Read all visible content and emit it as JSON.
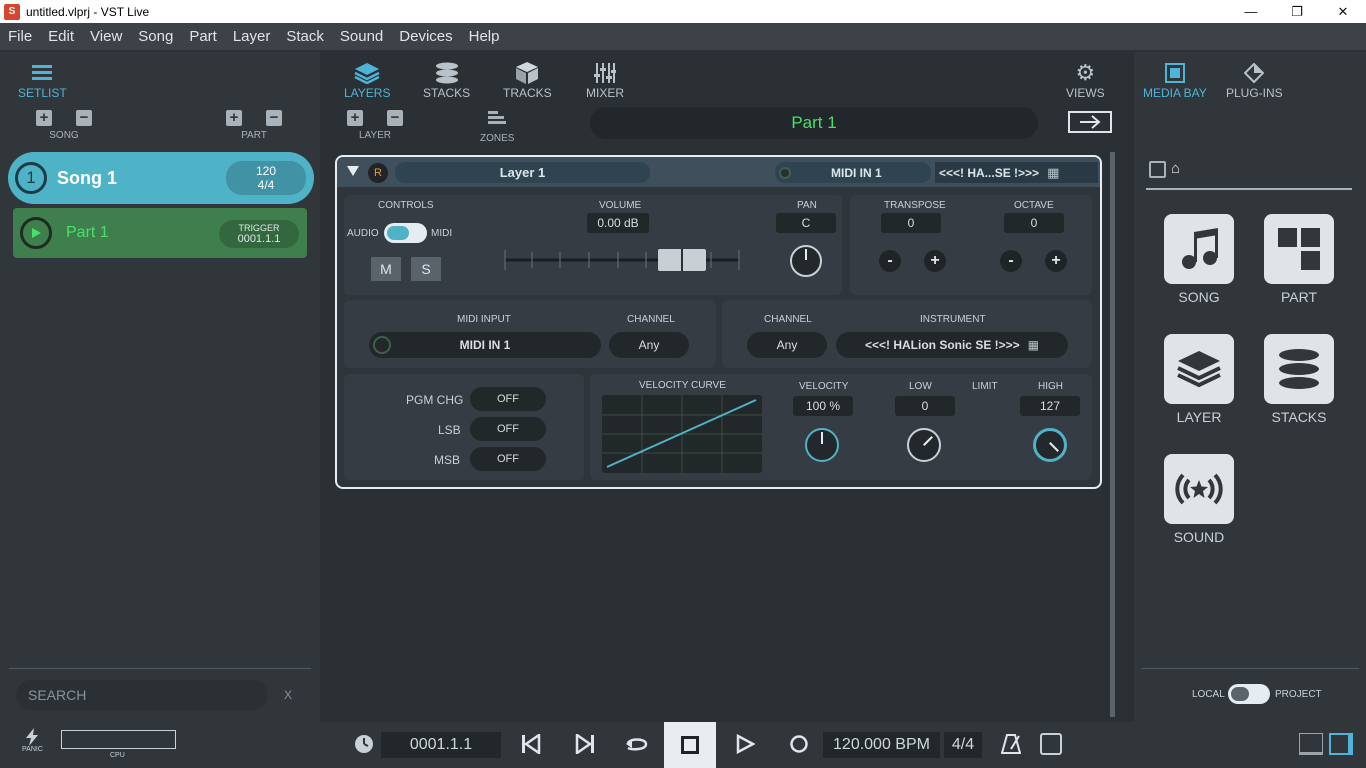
{
  "window": {
    "title": "untitled.vlprj - VST Live",
    "app_icon_text": "S"
  },
  "menu": [
    "File",
    "Edit",
    "View",
    "Song",
    "Part",
    "Layer",
    "Stack",
    "Sound",
    "Devices",
    "Help"
  ],
  "left": {
    "setlist_label": "SETLIST",
    "song_label": "SONG",
    "part_label": "PART",
    "song": {
      "number": "1",
      "name": "Song 1",
      "tempo": "120",
      "signature": "4/4"
    },
    "part": {
      "name": "Part 1",
      "trigger_label": "TRIGGER",
      "trigger_value": "0001.1.1"
    },
    "search_placeholder": "SEARCH",
    "search_clear": "X"
  },
  "center": {
    "tabs": [
      "LAYERS",
      "STACKS",
      "TRACKS",
      "MIXER"
    ],
    "views_label": "VIEWS",
    "layer_label": "LAYER",
    "zones_label": "ZONES",
    "part_title": "Part 1",
    "layer": {
      "name": "Layer 1",
      "r_badge": "R",
      "midi_in_head": "MIDI IN 1",
      "instrument_head": "<<<! HA...SE !>>>",
      "controls_label": "CONTROLS",
      "audio_label": "AUDIO",
      "midi_label": "MIDI",
      "m_btn": "M",
      "s_btn": "S",
      "volume_label": "VOLUME",
      "volume_value": "0.00 dB",
      "pan_label": "PAN",
      "pan_value": "C",
      "transpose_label": "TRANSPOSE",
      "transpose_value": "0",
      "octave_label": "OCTAVE",
      "octave_value": "0",
      "minus": "-",
      "plus": "+",
      "midi_input_label": "MIDI INPUT",
      "midi_input_value": "MIDI IN 1",
      "channel_label": "CHANNEL",
      "channel_value": "Any",
      "channel2_label": "CHANNEL",
      "channel2_value": "Any",
      "instrument_label": "INSTRUMENT",
      "instrument_value": "<<<! HALion Sonic SE !>>>",
      "pgm_label": "PGM CHG",
      "lsb_label": "LSB",
      "msb_label": "MSB",
      "off": "OFF",
      "vel_curve_label": "VELOCITY CURVE",
      "velocity_label": "VELOCITY",
      "velocity_value": "100 %",
      "low_label": "LOW",
      "low_value": "0",
      "limit_label": "LIMIT",
      "high_label": "HIGH",
      "high_value": "127"
    }
  },
  "right": {
    "media_bay_label": "MEDIA BAY",
    "plugins_label": "PLUG-INS",
    "tiles": [
      "SONG",
      "PART",
      "LAYER",
      "STACKS",
      "SOUND"
    ],
    "local_label": "LOCAL",
    "project_label": "PROJECT"
  },
  "transport": {
    "panic_label": "PANIC",
    "cpu_label": "CPU",
    "position": "0001.1.1",
    "tempo": "120.000 BPM",
    "signature": "4/4"
  },
  "colors": {
    "accent": "#4fb3c8",
    "part_green": "#3f7f4d",
    "green_text": "#49e06a"
  }
}
